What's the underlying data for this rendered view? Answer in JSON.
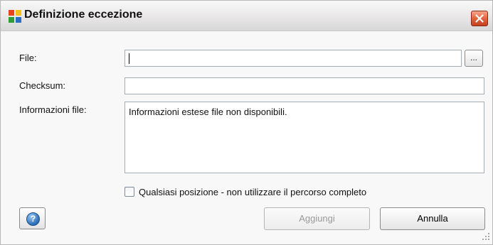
{
  "window": {
    "title": "Definizione eccezione"
  },
  "form": {
    "file_label": "File:",
    "file_value": "",
    "browse_label": "...",
    "checksum_label": "Checksum:",
    "checksum_value": "",
    "info_label": "Informazioni file:",
    "info_text": "Informazioni estese file non disponibili.",
    "checkbox_label": "Qualsiasi posizione - non utilizzare il percorso completo",
    "checkbox_checked": false
  },
  "buttons": {
    "help_label": "?",
    "add_label": "Aggiungi",
    "add_enabled": false,
    "cancel_label": "Annulla"
  },
  "colors": {
    "close_button": "#d9532e",
    "field_border": "#a5acb5",
    "window_bg": "#f8f8f8"
  },
  "icons": {
    "app": "avg-logo-icon",
    "close": "close-icon",
    "help": "help-icon"
  }
}
